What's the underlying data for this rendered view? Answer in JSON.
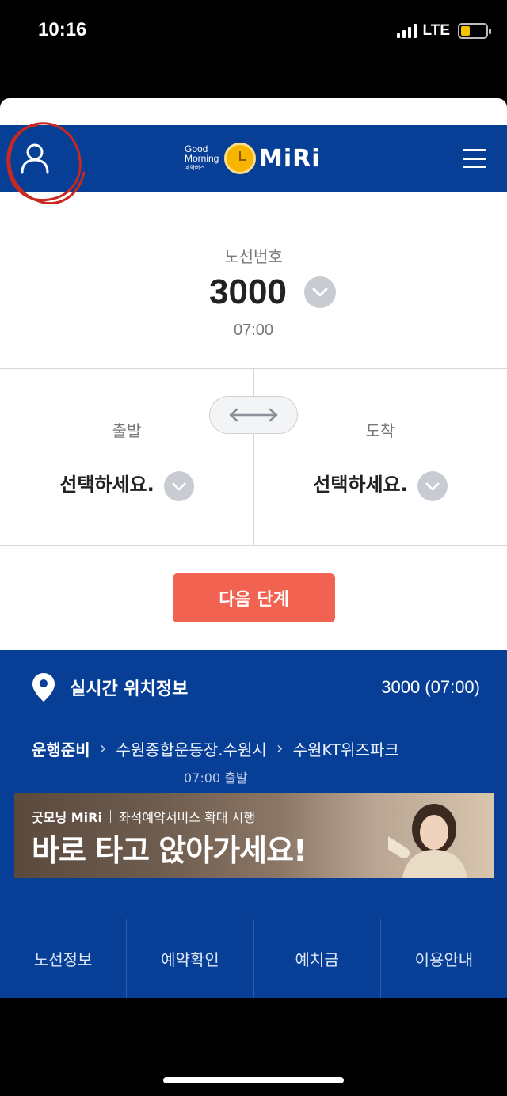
{
  "status_bar": {
    "time": "10:16",
    "network": "LTE",
    "battery_level": 0.35,
    "battery_color": "#f5c400"
  },
  "header": {
    "logo_line1": "Good",
    "logo_line2": "Morning",
    "logo_line3": "예약버스",
    "logo_text": "MiRi",
    "profile_icon": "user-icon",
    "menu_icon": "hamburger-menu-icon",
    "annotation_color": "#c8281e"
  },
  "route": {
    "label": "노선번호",
    "number": "3000",
    "time": "07:00"
  },
  "departure": {
    "label": "출발",
    "value": "선택하세요."
  },
  "arrival": {
    "label": "도착",
    "value": "선택하세요."
  },
  "next_button": "다음 단계",
  "location": {
    "title": "실시간 위치정보",
    "route_time": "3000 (07:00)",
    "status": "운행준비",
    "stop1": "수원종합운동장.수원시",
    "stop2": "수원KT위즈파크",
    "depart_time": "07:00 출발"
  },
  "banner": {
    "brand": "굿모닝 MiRi",
    "subtitle": "좌석예약서비스 확대 시행",
    "headline": "바로 타고 앉아가세요!"
  },
  "tabs": [
    "노선정보",
    "예약확인",
    "예치금",
    "이용안내"
  ],
  "colors": {
    "brand_blue": "#073f97",
    "next_button": "#f26250",
    "logo_yellow": "#f7b500"
  }
}
